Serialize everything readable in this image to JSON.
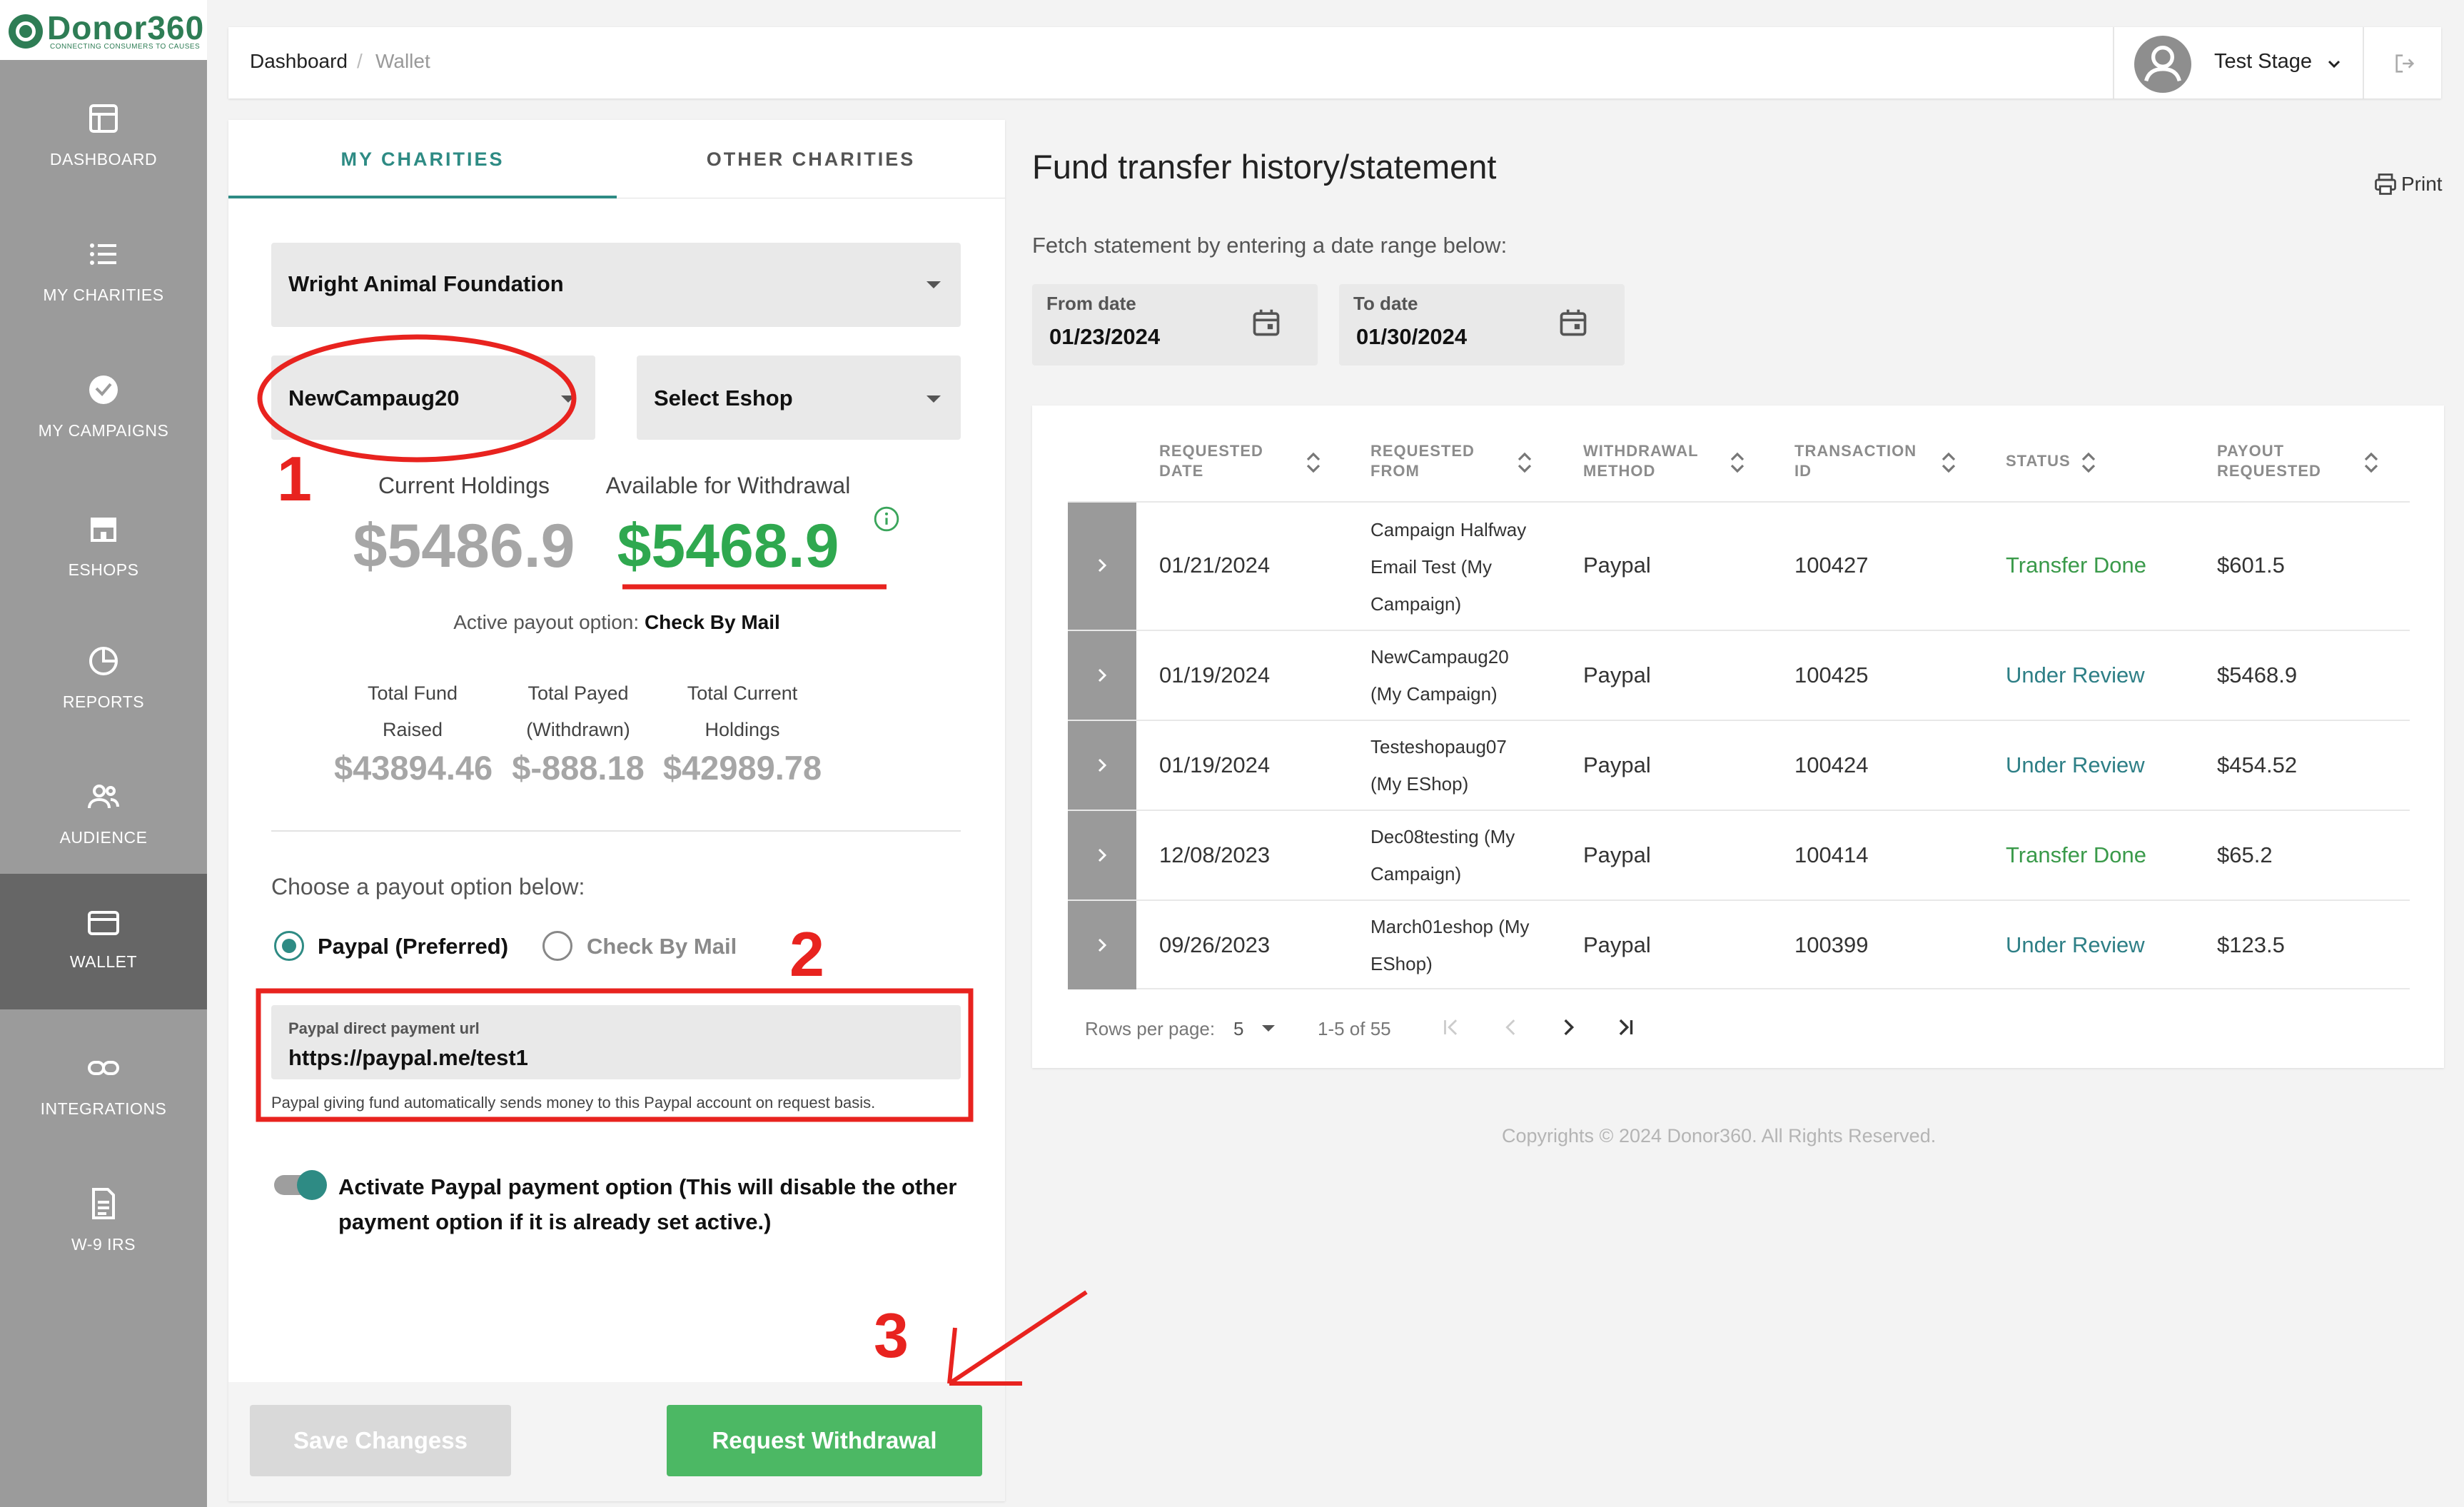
{
  "brand": {
    "name": "Donor360",
    "tagline": "CONNECTING CONSUMERS TO CAUSES"
  },
  "sidebar": {
    "items": [
      {
        "label": "DASHBOARD",
        "icon": "dashboard-icon"
      },
      {
        "label": "MY CHARITIES",
        "icon": "list-icon"
      },
      {
        "label": "MY CAMPAIGNS",
        "icon": "campaign-icon"
      },
      {
        "label": "ESHOPS",
        "icon": "store-icon"
      },
      {
        "label": "REPORTS",
        "icon": "pie-chart-icon"
      },
      {
        "label": "AUDIENCE",
        "icon": "people-icon"
      },
      {
        "label": "WALLET",
        "icon": "wallet-icon",
        "active": true
      },
      {
        "label": "INTEGRATIONS",
        "icon": "link-icon"
      },
      {
        "label": "W-9 IRS",
        "icon": "document-icon"
      }
    ]
  },
  "header": {
    "breadcrumb": [
      "Dashboard",
      "Wallet"
    ],
    "separator": "/",
    "user_name": "Test Stage"
  },
  "left": {
    "tabs": [
      "MY CHARITIES",
      "OTHER CHARITIES"
    ],
    "charity_select": "Wright Animal Foundation",
    "campaign_select": "NewCampaug20",
    "eshop_select": "Select Eshop",
    "current_holdings_label": "Current Holdings",
    "available_label": "Available for Withdrawal",
    "current_holdings": "$5486.9",
    "available": "$5468.9",
    "active_payout_label": "Active payout option:",
    "active_payout_value": "Check By Mail",
    "stats": [
      {
        "label1": "Total Fund",
        "label2": "Raised",
        "value": "$43894.46"
      },
      {
        "label1": "Total Payed",
        "label2": "(Withdrawn)",
        "value": "$-888.18"
      },
      {
        "label1": "Total Current",
        "label2": "Holdings",
        "value": "$42989.78"
      }
    ],
    "payout_prompt": "Choose a payout option below:",
    "payout_options": [
      "Paypal (Preferred)",
      "Check By Mail"
    ],
    "paypal_url_label": "Paypal direct payment url",
    "paypal_url_value": "https://paypal.me/test1",
    "paypal_help": "Paypal giving fund automatically sends money to this Paypal account on request basis.",
    "activate_text_1": "Activate Paypal payment option (This will disable the other",
    "activate_text_2": "payment option if it is already set active.)",
    "save_button": "Save Changess",
    "request_button": "Request Withdrawal"
  },
  "right": {
    "title": "Fund transfer history/statement",
    "print": "Print",
    "fetch_prompt": "Fetch statement by entering a date range below:",
    "from_label": "From date",
    "from_value": "01/23/2024",
    "to_label": "To date",
    "to_value": "01/30/2024",
    "columns": [
      [
        "REQUESTED",
        "DATE"
      ],
      [
        "REQUESTED",
        "FROM"
      ],
      [
        "WITHDRAWAL",
        "METHOD"
      ],
      [
        "TRANSACTION",
        "ID"
      ],
      [
        "STATUS",
        ""
      ],
      [
        "PAYOUT",
        "REQUESTED"
      ]
    ],
    "rows": [
      {
        "date": "01/21/2024",
        "from": [
          "Campaign Halfway",
          "Email Test (My",
          "Campaign)"
        ],
        "method": "Paypal",
        "txn": "100427",
        "status": "Transfer Done",
        "payout": "$601.5"
      },
      {
        "date": "01/19/2024",
        "from": [
          "NewCampaug20",
          "(My Campaign)"
        ],
        "method": "Paypal",
        "txn": "100425",
        "status": "Under Review",
        "payout": "$5468.9"
      },
      {
        "date": "01/19/2024",
        "from": [
          "Testeshopaug07",
          "(My EShop)"
        ],
        "method": "Paypal",
        "txn": "100424",
        "status": "Under Review",
        "payout": "$454.52"
      },
      {
        "date": "12/08/2023",
        "from": [
          "Dec08testing (My",
          "Campaign)"
        ],
        "method": "Paypal",
        "txn": "100414",
        "status": "Transfer Done",
        "payout": "$65.2"
      },
      {
        "date": "09/26/2023",
        "from": [
          "March01eshop (My",
          "EShop)"
        ],
        "method": "Paypal",
        "txn": "100399",
        "status": "Under Review",
        "payout": "$123.5"
      }
    ],
    "rows_per_page_label": "Rows per page:",
    "rows_per_page": "5",
    "range": "1-5 of 55"
  },
  "footer": "Copyrights © 2024 Donor360. All Rights Reserved.",
  "annotations": [
    "1",
    "2",
    "3"
  ],
  "colors": {
    "accent": "#2e8b84",
    "green": "#2fa84f",
    "status_done": "#3a9a4a",
    "status_review": "#2e7f86",
    "annotation": "#e8231f"
  }
}
